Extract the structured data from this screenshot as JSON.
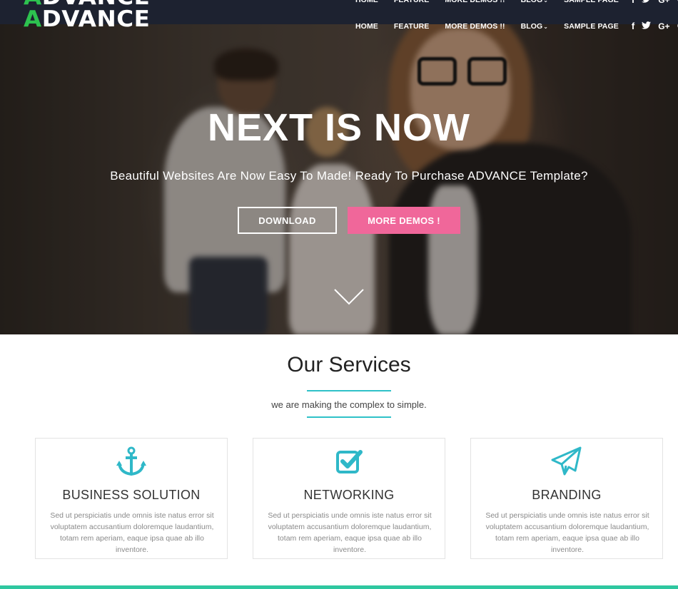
{
  "brand": {
    "logo_first": "A",
    "logo_rest": "DVANCE",
    "accent_color": "#2dc24f"
  },
  "nav": {
    "items": [
      {
        "label": "HOME"
      },
      {
        "label": "FEATURE"
      },
      {
        "label": "MORE DEMOS !!"
      },
      {
        "label": "BLOG",
        "caret": "⌄"
      },
      {
        "label": "SAMPLE PAGE"
      }
    ],
    "social": {
      "facebook": "f",
      "twitter": "twitter-icon",
      "google_plus": "G+",
      "search": "search-icon"
    }
  },
  "hero": {
    "title": "NEXT IS NOW",
    "subtitle": "Beautiful Websites Are Now Easy To Made! Ready To Purchase ADVANCE Template?",
    "download_label": "DOWNLOAD",
    "more_demos_label": "MORE DEMOS !",
    "more_demos_color": "#f0679a"
  },
  "services": {
    "title": "Our Services",
    "subtitle": "we are making the complex to simple.",
    "accent_color": "#2fc1c8",
    "cards": [
      {
        "icon": "anchor-icon",
        "title": "BUSINESS SOLUTION",
        "text": "Sed ut perspiciatis unde omnis iste natus error sit voluptatem accusantium doloremque laudantium, totam rem aperiam, eaque ipsa quae ab illo inventore."
      },
      {
        "icon": "check-square-icon",
        "title": "NETWORKING",
        "text": "Sed ut perspiciatis unde omnis iste natus error sit voluptatem accusantium doloremque laudantium, totam rem aperiam, eaque ipsa quae ab illo inventore."
      },
      {
        "icon": "paper-plane-icon",
        "title": "BRANDING",
        "text": "Sed ut perspiciatis unde omnis iste natus error sit voluptatem accusantium doloremque laudantium, totam rem aperiam, eaque ipsa quae ab illo inventore."
      }
    ]
  }
}
